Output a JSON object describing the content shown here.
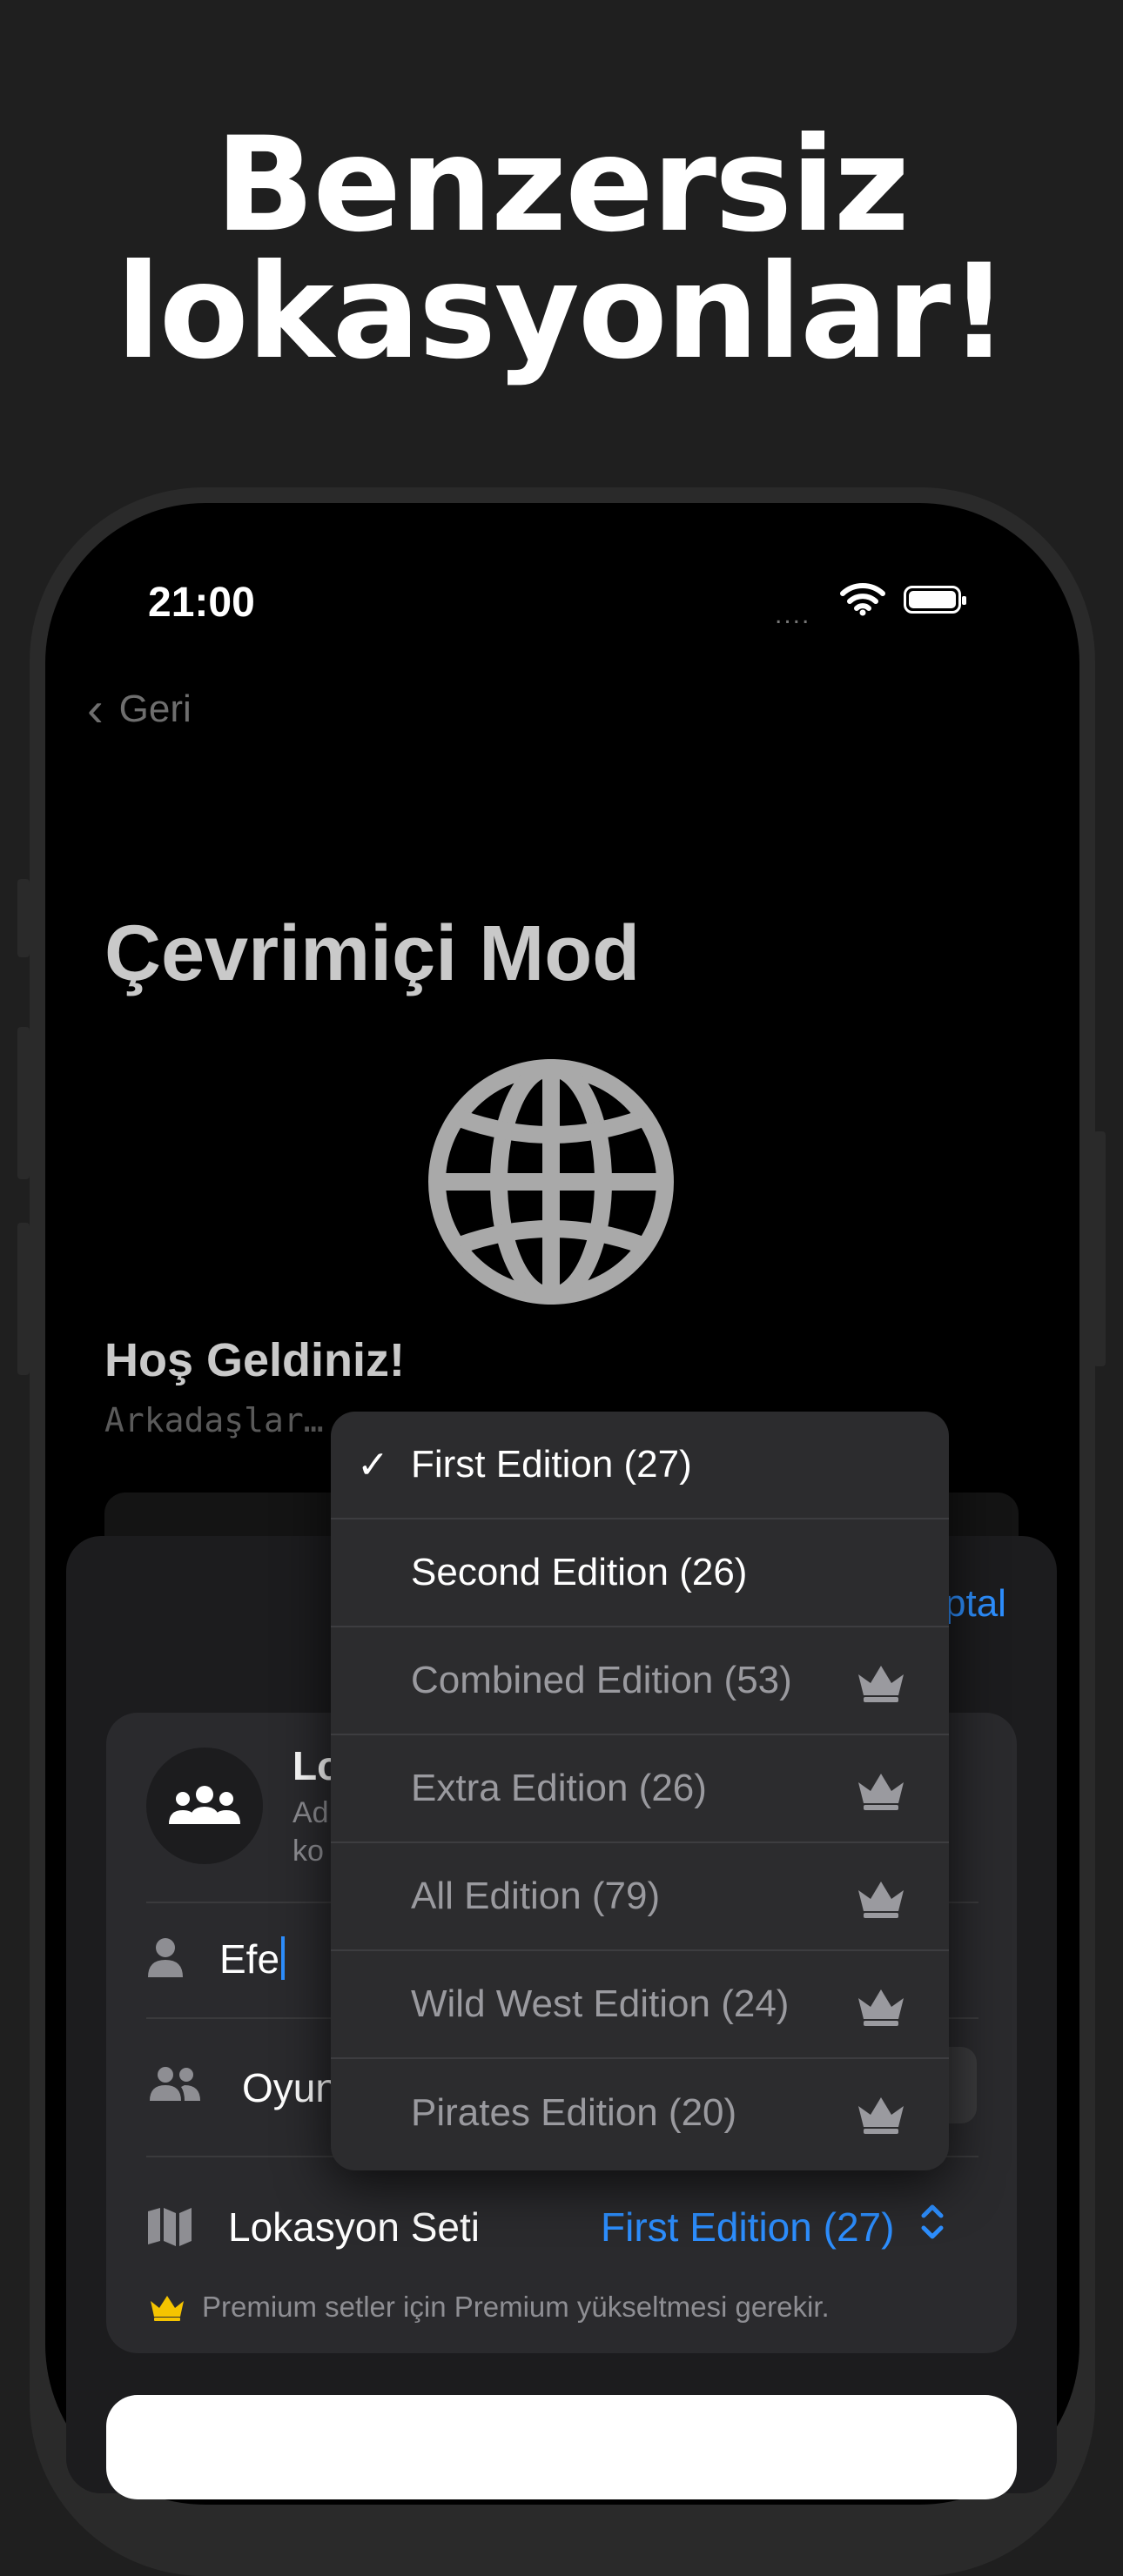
{
  "headline": {
    "line1": "Benzersiz",
    "line2": "lokasyonlar!"
  },
  "status_bar": {
    "time": "21:00",
    "signal": "....",
    "wifi_icon": "wifi-icon",
    "battery_icon": "battery-icon"
  },
  "nav": {
    "back_label": "Geri",
    "back_icon": "chevron-left-icon"
  },
  "page": {
    "title": "Çevrimiçi Mod",
    "hero_icon": "globe-icon",
    "welcome": "Hoş Geldiniz!",
    "subtext": "Arkadaşlar…"
  },
  "sheet": {
    "cancel_label": "ptal",
    "card": {
      "avatar_icon": "group-icon",
      "title_partial": "Lo",
      "desc_line1": "Ad",
      "desc_line2": "ko"
    },
    "name_field": {
      "icon": "person-icon",
      "value": "Efe"
    },
    "players_row": {
      "icon": "people-icon",
      "label": "Oyun"
    },
    "location_set": {
      "icon": "map-icon",
      "label": "Lokasyon Seti",
      "value": "First Edition (27)",
      "chevron_icon": "updown-chevron-icon"
    },
    "premium_note": {
      "icon": "crown-icon",
      "text": "Premium setler için Premium yükseltmesi gerekir."
    }
  },
  "menu": {
    "items": [
      {
        "label": "First Edition (27)",
        "selected": true,
        "premium": false
      },
      {
        "label": "Second Edition (26)",
        "selected": false,
        "premium": false
      },
      {
        "label": "Combined Edition (53)",
        "selected": false,
        "premium": true
      },
      {
        "label": "Extra Edition (26)",
        "selected": false,
        "premium": true
      },
      {
        "label": "All Edition (79)",
        "selected": false,
        "premium": true
      },
      {
        "label": "Wild West Edition (24)",
        "selected": false,
        "premium": true
      },
      {
        "label": "Pirates Edition (20)",
        "selected": false,
        "premium": true
      }
    ],
    "check_glyph": "✓",
    "premium_icon": "crown-icon"
  },
  "colors": {
    "accent": "#2d8fff",
    "background": "#1f1f1f",
    "crown_gold": "#f5c400"
  }
}
